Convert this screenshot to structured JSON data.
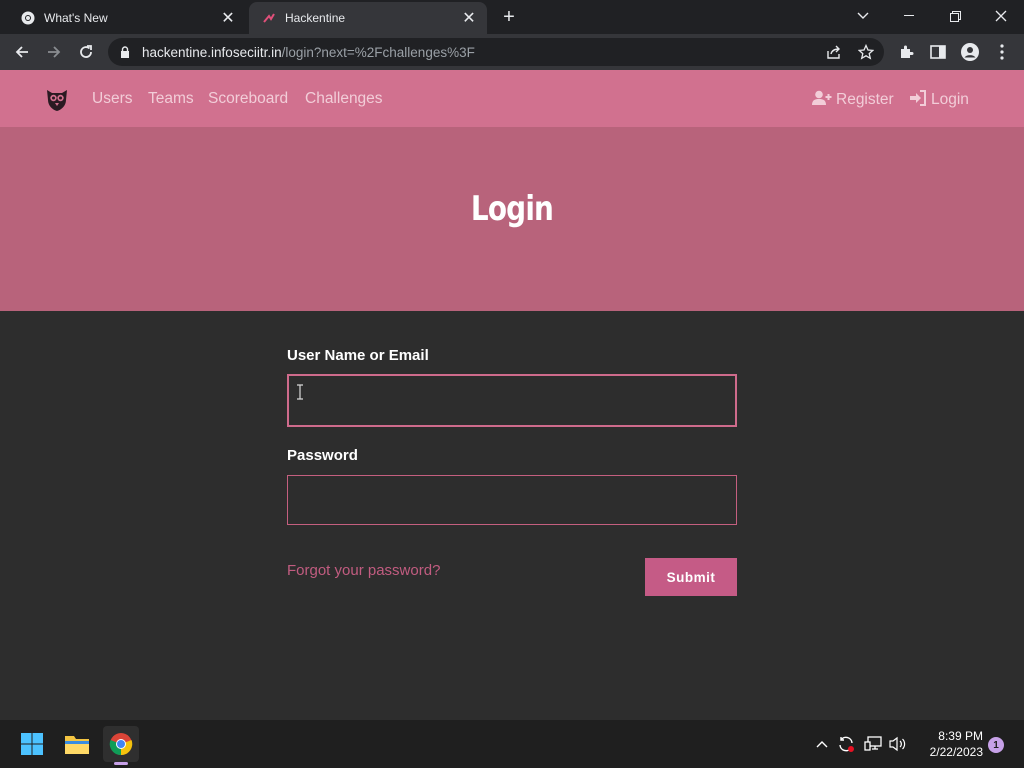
{
  "browser": {
    "tabs": [
      {
        "title": "What's New",
        "icon": "chrome-icon"
      },
      {
        "title": "Hackentine",
        "icon": "site-favicon",
        "active": true
      }
    ],
    "new_tab_label": "+",
    "url_host": "hackentine.infoseciitr.in",
    "url_path": "/login?next=%2Fchallenges%3F"
  },
  "site": {
    "nav_links": [
      "Users",
      "Teams",
      "Scoreboard",
      "Challenges"
    ],
    "register_label": "Register",
    "login_label": "Login",
    "page_title": "Login",
    "colors": {
      "nav": "#d1718f",
      "hero": "#b8637b",
      "accent": "#c55b86",
      "body": "#2d2d2d"
    }
  },
  "form": {
    "username_label": "User Name or Email",
    "username_value": "",
    "password_label": "Password",
    "password_value": "",
    "forgot_link": "Forgot your password?",
    "submit_label": "Submit"
  },
  "taskbar": {
    "time": "8:39 PM",
    "date": "2/22/2023",
    "notification_count": "1"
  }
}
